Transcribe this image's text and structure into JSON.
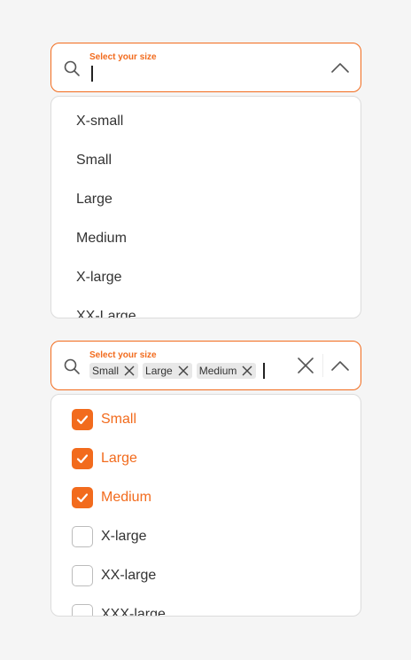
{
  "colors": {
    "accent": "#f26b1d",
    "text": "#333333",
    "border": "#dcdcdc"
  },
  "single_select": {
    "label": "Select your size",
    "value": "",
    "options": [
      "X-small",
      "Small",
      "Large",
      "Medium",
      "X-large",
      "XX-Large"
    ]
  },
  "multi_select": {
    "label": "Select your size",
    "chips": [
      "Small",
      "Large",
      "Medium"
    ],
    "options": [
      {
        "label": "Small",
        "checked": true
      },
      {
        "label": "Large",
        "checked": true
      },
      {
        "label": "Medium",
        "checked": true
      },
      {
        "label": "X-large",
        "checked": false
      },
      {
        "label": "XX-large",
        "checked": false
      },
      {
        "label": "XXX-large",
        "checked": false
      }
    ]
  }
}
